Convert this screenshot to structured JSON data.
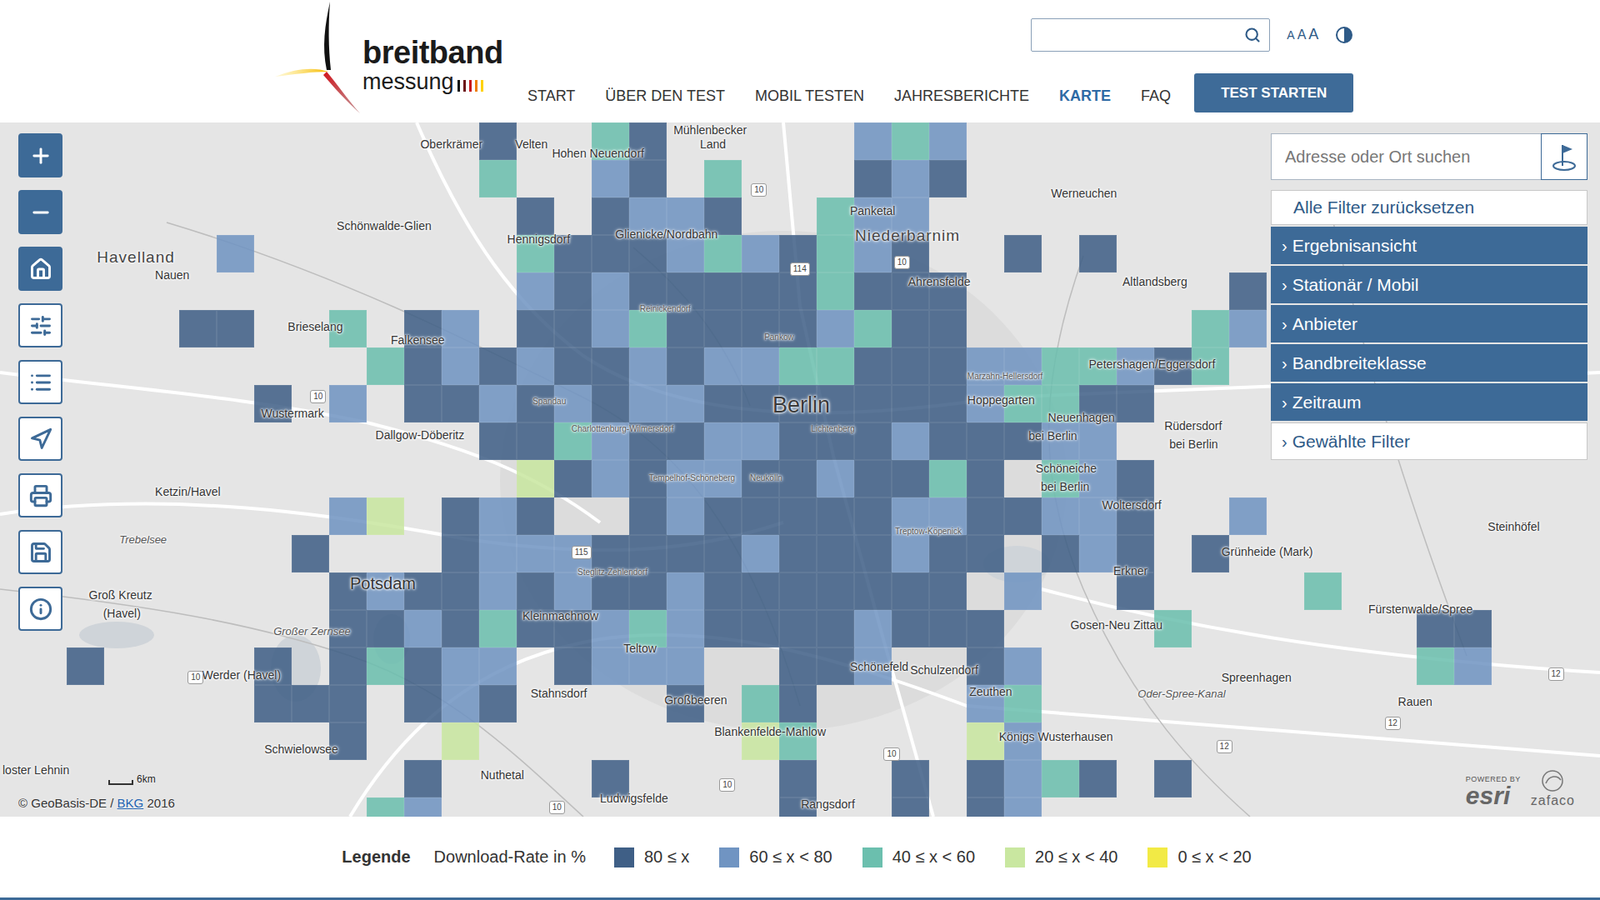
{
  "header": {
    "logo": {
      "line1": "breitband",
      "line2": "messung"
    },
    "search": {
      "placeholder": ""
    },
    "font_sizes": [
      "A",
      "A",
      "A"
    ],
    "nav": [
      {
        "label": "START",
        "selected": false
      },
      {
        "label": "ÜBER DEN TEST",
        "selected": false
      },
      {
        "label": "MOBIL TESTEN",
        "selected": false
      },
      {
        "label": "JAHRESBERICHTE",
        "selected": false
      },
      {
        "label": "KARTE",
        "selected": true
      },
      {
        "label": "FAQ",
        "selected": false
      }
    ],
    "cta": "TEST STARTEN"
  },
  "map": {
    "tools": [
      {
        "filled": true
      },
      {
        "filled": true
      },
      {
        "filled": true
      },
      {
        "filled": false
      },
      {
        "filled": false
      },
      {
        "filled": false
      },
      {
        "filled": false
      },
      {
        "filled": false
      },
      {
        "filled": false
      }
    ],
    "panel": {
      "search_placeholder": "Adresse oder Ort suchen",
      "reset": "Alle Filter zurücksetzen",
      "filters": [
        {
          "label": "Ergebnisansicht",
          "chevron": "›",
          "kind": "accordion"
        },
        {
          "label": "Stationär / Mobil",
          "chevron": "›",
          "kind": "accordion"
        },
        {
          "label": "Anbieter",
          "chevron": "›",
          "kind": "accordion"
        },
        {
          "label": "Bandbreiteklasse",
          "chevron": "›",
          "kind": "accordion"
        },
        {
          "label": "Zeitraum",
          "chevron": "›",
          "kind": "accordion"
        },
        {
          "label": "Gewählte Filter",
          "chevron": "›",
          "kind": "summary"
        }
      ]
    },
    "labels": [
      {
        "text": "Oberkrämer",
        "kind": "place"
      },
      {
        "text": "Velten",
        "kind": "place"
      },
      {
        "text": "Hohen Neuendorf",
        "kind": "place"
      },
      {
        "text": "Mühlenbecker",
        "kind": "place"
      },
      {
        "text": "Land",
        "kind": "place"
      },
      {
        "text": "Schönwalde-Glien",
        "kind": "place"
      },
      {
        "text": "Havelland",
        "kind": "region"
      },
      {
        "text": "Nauen",
        "kind": "place"
      },
      {
        "text": "Hennigsdorf",
        "kind": "place"
      },
      {
        "text": "Glienicke/Nordbahn",
        "kind": "place"
      },
      {
        "text": "Panketal",
        "kind": "place"
      },
      {
        "text": "Niederbarnim",
        "kind": "region"
      },
      {
        "text": "Werneuchen",
        "kind": "place"
      },
      {
        "text": "Ahrensfelde",
        "kind": "place"
      },
      {
        "text": "Altlandsberg",
        "kind": "place"
      },
      {
        "text": "Brieselang",
        "kind": "place"
      },
      {
        "text": "Falkensee",
        "kind": "place"
      },
      {
        "text": "Wustermark",
        "kind": "place"
      },
      {
        "text": "Dallgow-Döberitz",
        "kind": "place"
      },
      {
        "text": "Berlin",
        "kind": "city"
      },
      {
        "text": "Hoppegarten",
        "kind": "place"
      },
      {
        "text": "Petershagen/Eggersdorf",
        "kind": "place"
      },
      {
        "text": "Rüdersdorf",
        "kind": "place"
      },
      {
        "text": "bei Berlin",
        "kind": "place"
      },
      {
        "text": "Neuenhagen",
        "kind": "place"
      },
      {
        "text": "bei Berlin",
        "kind": "place"
      },
      {
        "text": "Schöneiche",
        "kind": "place"
      },
      {
        "text": "bei Berlin",
        "kind": "place"
      },
      {
        "text": "Woltersdorf",
        "kind": "place"
      },
      {
        "text": "Erkner",
        "kind": "place"
      },
      {
        "text": "Ketzin/Havel",
        "kind": "place"
      },
      {
        "text": "Trebelsee",
        "kind": "water"
      },
      {
        "text": "Steinhöfel",
        "kind": "place"
      },
      {
        "text": "Grünheide (Mark)",
        "kind": "place"
      },
      {
        "text": "Potsdam",
        "kind": "town"
      },
      {
        "text": "Kleinmachnow",
        "kind": "place"
      },
      {
        "text": "Teltow",
        "kind": "place"
      },
      {
        "text": "Stahnsdorf",
        "kind": "place"
      },
      {
        "text": "Großbeeren",
        "kind": "place"
      },
      {
        "text": "Blankenfelde-Mahlow",
        "kind": "place"
      },
      {
        "text": "Schönefeld",
        "kind": "place"
      },
      {
        "text": "Schulzendorf",
        "kind": "place"
      },
      {
        "text": "Zeuthen",
        "kind": "place"
      },
      {
        "text": "Königs Wusterhausen",
        "kind": "place"
      },
      {
        "text": "Gosen-Neu Zittau",
        "kind": "place"
      },
      {
        "text": "Fürstenwalde/Spree",
        "kind": "place"
      },
      {
        "text": "Spreenhagen",
        "kind": "place"
      },
      {
        "text": "Rauen",
        "kind": "place"
      },
      {
        "text": "Groß Kreutz",
        "kind": "place"
      },
      {
        "text": "(Havel)",
        "kind": "place"
      },
      {
        "text": "Werder (Havel)",
        "kind": "place"
      },
      {
        "text": "Schwielowsee",
        "kind": "place"
      },
      {
        "text": "loster Lehnin",
        "kind": "place"
      },
      {
        "text": "Nuthetal",
        "kind": "place"
      },
      {
        "text": "Ludwigsfelde",
        "kind": "place"
      },
      {
        "text": "Rangsdorf",
        "kind": "place"
      },
      {
        "text": "Spandau",
        "kind": "district"
      },
      {
        "text": "Charlottenburg-Wilmersdorf",
        "kind": "district"
      },
      {
        "text": "Tempelhof-Schöneberg",
        "kind": "district"
      },
      {
        "text": "Neukölln",
        "kind": "district"
      },
      {
        "text": "Treptow-Köpenick",
        "kind": "district"
      },
      {
        "text": "Steglitz-Zehlendorf",
        "kind": "district"
      },
      {
        "text": "Reinickendorf",
        "kind": "district"
      },
      {
        "text": "Pankow",
        "kind": "district"
      },
      {
        "text": "Lichtenberg",
        "kind": "district"
      },
      {
        "text": "Marzahn-Hellersdorf",
        "kind": "district"
      },
      {
        "text": "Großer Zernsee",
        "kind": "water"
      },
      {
        "text": "Oder-Spree-Kanal",
        "kind": "water"
      },
      {
        "text": "10",
        "kind": "road"
      },
      {
        "text": "114",
        "kind": "road"
      },
      {
        "text": "10",
        "kind": "road"
      },
      {
        "text": "10",
        "kind": "road"
      },
      {
        "text": "115",
        "kind": "road"
      },
      {
        "text": "10",
        "kind": "road"
      },
      {
        "text": "10",
        "kind": "road"
      },
      {
        "text": "12",
        "kind": "road"
      },
      {
        "text": "12",
        "kind": "road"
      },
      {
        "text": "12",
        "kind": "road"
      },
      {
        "text": "10",
        "kind": "road"
      },
      {
        "text": "10",
        "kind": "road"
      }
    ],
    "grid": {
      "values": [
        [
          0,
          0,
          0,
          0,
          0,
          0,
          0,
          0,
          0,
          0,
          0,
          0,
          1,
          0,
          0,
          3,
          1,
          0,
          0,
          0,
          0,
          0,
          2,
          3,
          2,
          0,
          0,
          0,
          0,
          0,
          0,
          0,
          0,
          0,
          0,
          0,
          0,
          0,
          0,
          0
        ],
        [
          0,
          0,
          0,
          0,
          0,
          0,
          0,
          0,
          0,
          0,
          0,
          0,
          3,
          0,
          0,
          2,
          1,
          0,
          3,
          0,
          0,
          0,
          1,
          2,
          1,
          0,
          0,
          0,
          0,
          0,
          0,
          0,
          0,
          0,
          0,
          0,
          0,
          0,
          0,
          0
        ],
        [
          0,
          0,
          0,
          0,
          0,
          0,
          0,
          0,
          0,
          0,
          0,
          0,
          0,
          1,
          0,
          1,
          2,
          2,
          1,
          0,
          0,
          3,
          2,
          2,
          0,
          0,
          0,
          0,
          0,
          0,
          0,
          0,
          0,
          0,
          0,
          0,
          0,
          0,
          0,
          0
        ],
        [
          0,
          0,
          0,
          0,
          0,
          2,
          0,
          0,
          0,
          0,
          0,
          0,
          0,
          3,
          1,
          1,
          1,
          2,
          3,
          2,
          1,
          3,
          2,
          1,
          0,
          0,
          1,
          0,
          1,
          0,
          0,
          0,
          0,
          0,
          0,
          0,
          0,
          0,
          0,
          0
        ],
        [
          0,
          0,
          0,
          0,
          0,
          0,
          0,
          0,
          0,
          0,
          0,
          0,
          0,
          2,
          1,
          2,
          1,
          1,
          1,
          1,
          1,
          3,
          1,
          1,
          1,
          0,
          0,
          0,
          0,
          0,
          0,
          0,
          1,
          0,
          0,
          0,
          0,
          0,
          0,
          0
        ],
        [
          0,
          0,
          0,
          0,
          1,
          1,
          0,
          0,
          3,
          0,
          1,
          2,
          0,
          1,
          1,
          2,
          3,
          1,
          1,
          1,
          1,
          2,
          3,
          1,
          1,
          0,
          0,
          0,
          0,
          0,
          0,
          3,
          2,
          0,
          0,
          0,
          0,
          0,
          0,
          0
        ],
        [
          0,
          0,
          0,
          0,
          0,
          0,
          0,
          0,
          0,
          3,
          1,
          2,
          1,
          2,
          1,
          1,
          2,
          1,
          2,
          2,
          3,
          3,
          1,
          1,
          1,
          2,
          2,
          3,
          3,
          2,
          1,
          3,
          0,
          0,
          0,
          0,
          0,
          0,
          0,
          0
        ],
        [
          0,
          0,
          0,
          0,
          0,
          0,
          1,
          0,
          2,
          0,
          1,
          1,
          2,
          1,
          2,
          1,
          2,
          2,
          1,
          1,
          1,
          1,
          1,
          1,
          1,
          2,
          3,
          3,
          1,
          1,
          0,
          0,
          0,
          0,
          0,
          0,
          0,
          0,
          0,
          0
        ],
        [
          0,
          0,
          0,
          0,
          0,
          0,
          0,
          0,
          0,
          0,
          0,
          0,
          1,
          1,
          3,
          2,
          1,
          1,
          2,
          2,
          1,
          1,
          1,
          2,
          1,
          1,
          1,
          2,
          2,
          0,
          0,
          0,
          0,
          0,
          0,
          0,
          0,
          0,
          0,
          0
        ],
        [
          0,
          0,
          0,
          0,
          0,
          0,
          0,
          0,
          0,
          0,
          0,
          0,
          0,
          4,
          1,
          2,
          1,
          2,
          2,
          1,
          1,
          2,
          1,
          1,
          3,
          1,
          0,
          3,
          2,
          1,
          0,
          0,
          0,
          0,
          0,
          0,
          0,
          0,
          0,
          0
        ],
        [
          0,
          0,
          0,
          0,
          0,
          0,
          0,
          0,
          2,
          4,
          0,
          1,
          2,
          1,
          0,
          0,
          1,
          2,
          1,
          1,
          1,
          1,
          1,
          2,
          2,
          1,
          1,
          2,
          2,
          1,
          0,
          0,
          2,
          0,
          0,
          0,
          0,
          0,
          0,
          0
        ],
        [
          0,
          0,
          0,
          0,
          0,
          0,
          0,
          1,
          0,
          0,
          0,
          1,
          2,
          2,
          2,
          1,
          1,
          1,
          1,
          2,
          1,
          1,
          1,
          2,
          1,
          1,
          0,
          1,
          2,
          1,
          0,
          1,
          0,
          0,
          0,
          0,
          0,
          0,
          0,
          0
        ],
        [
          0,
          0,
          0,
          0,
          0,
          0,
          0,
          0,
          1,
          2,
          1,
          1,
          2,
          1,
          2,
          1,
          1,
          2,
          1,
          1,
          1,
          1,
          1,
          1,
          1,
          0,
          2,
          0,
          0,
          1,
          0,
          0,
          0,
          0,
          3,
          0,
          0,
          0,
          0,
          0
        ],
        [
          0,
          0,
          0,
          0,
          0,
          0,
          0,
          0,
          1,
          1,
          2,
          1,
          3,
          1,
          1,
          2,
          3,
          2,
          1,
          1,
          1,
          1,
          2,
          1,
          1,
          1,
          0,
          0,
          0,
          0,
          3,
          0,
          0,
          0,
          0,
          0,
          0,
          1,
          1,
          0
        ],
        [
          0,
          1,
          0,
          0,
          0,
          0,
          1,
          0,
          1,
          3,
          1,
          2,
          2,
          0,
          1,
          2,
          2,
          2,
          0,
          0,
          1,
          1,
          2,
          0,
          0,
          1,
          2,
          0,
          0,
          0,
          0,
          0,
          0,
          0,
          0,
          0,
          0,
          3,
          2,
          0
        ],
        [
          0,
          0,
          0,
          0,
          0,
          0,
          1,
          1,
          1,
          0,
          1,
          2,
          1,
          0,
          0,
          0,
          0,
          1,
          0,
          3,
          1,
          0,
          0,
          0,
          0,
          2,
          3,
          0,
          0,
          0,
          0,
          0,
          0,
          0,
          0,
          0,
          0,
          0,
          0,
          0
        ],
        [
          0,
          0,
          0,
          0,
          0,
          0,
          0,
          0,
          1,
          0,
          0,
          4,
          0,
          0,
          0,
          0,
          0,
          0,
          0,
          4,
          3,
          0,
          0,
          0,
          0,
          4,
          2,
          0,
          0,
          0,
          0,
          0,
          0,
          0,
          0,
          0,
          0,
          0,
          0,
          0
        ],
        [
          0,
          0,
          0,
          0,
          0,
          0,
          0,
          0,
          0,
          0,
          1,
          0,
          0,
          0,
          0,
          1,
          0,
          0,
          0,
          0,
          1,
          0,
          0,
          1,
          0,
          1,
          2,
          3,
          1,
          0,
          1,
          0,
          0,
          0,
          0,
          0,
          0,
          0,
          0,
          0
        ],
        [
          0,
          0,
          0,
          0,
          0,
          0,
          0,
          0,
          0,
          3,
          2,
          0,
          0,
          0,
          0,
          0,
          0,
          0,
          0,
          0,
          1,
          0,
          0,
          1,
          0,
          1,
          2,
          0,
          0,
          0,
          0,
          0,
          0,
          0,
          0,
          0,
          0,
          0,
          0,
          0
        ]
      ]
    },
    "scale": "6km",
    "attribution": {
      "prefix": "© GeoBasis-DE / ",
      "link": "BKG",
      "suffix": " 2016"
    },
    "powered": {
      "caption": "POWERED BY",
      "brand": "esri",
      "partner": "zafaco"
    }
  },
  "legend": {
    "title": "Legende",
    "subtitle": "Download-Rate in %",
    "items": [
      {
        "label": "80 ≤ x",
        "color": "#3f5f86"
      },
      {
        "label": "60 ≤ x < 80",
        "color": "#7094c2"
      },
      {
        "label": "40 ≤ x < 60",
        "color": "#6bbfae"
      },
      {
        "label": "20 ≤ x < 40",
        "color": "#c9e7a0"
      },
      {
        "label": "0 ≤ x < 20",
        "color": "#f2ea45"
      }
    ]
  }
}
